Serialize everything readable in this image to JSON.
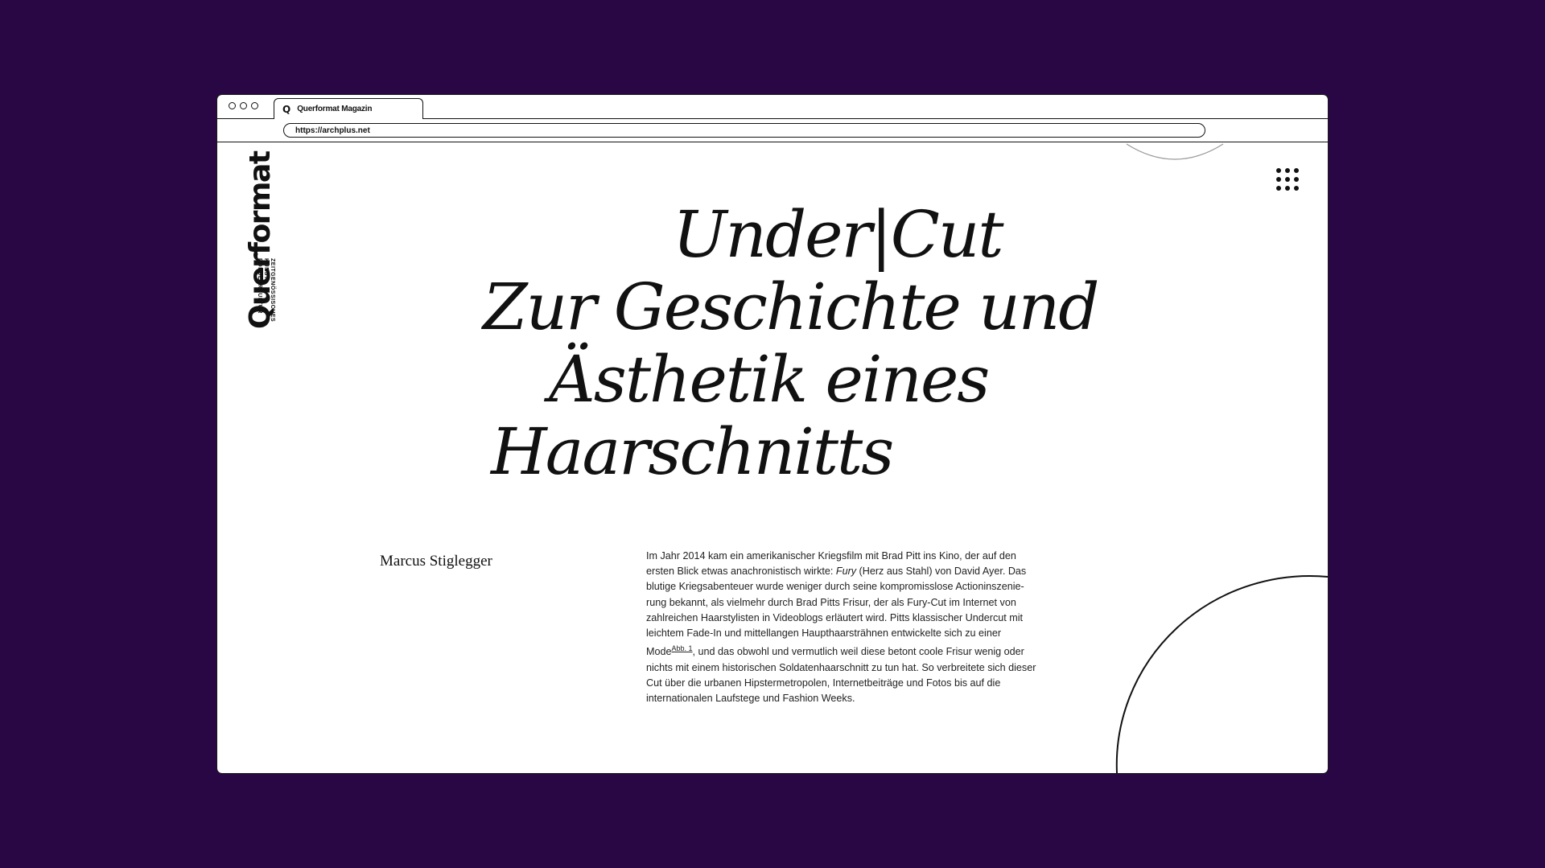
{
  "browser": {
    "tab_icon": "Q",
    "tab_title": "Querformat Magazin",
    "url": "https://archplus.net"
  },
  "site": {
    "logo_main": "Querformat",
    "logo_sub": [
      "ZEITGENÖSSISCHES",
      "KUNST",
      "POPULÄRKULTUR"
    ],
    "menu_icon": "grid-dots-icon"
  },
  "article": {
    "title_lines": [
      "Under|Cut",
      "Zur Geschichte und",
      "Ästhetik eines",
      "Haarschnitts"
    ],
    "author": "Marcus Stiglegger",
    "body_parts": {
      "p1": "Im Jahr 2014 kam ein amerikanischer Kriegsfilm mit Brad Pitt ins Kino, der auf den ersten Blick etwas anachronistisch wirkte: ",
      "em": "Fury",
      "p2": " (Herz aus Stahl) von David Ayer. Das blutige Kriegsabenteuer wurde weniger durch seine kompromisslose Actioninszenie­rung bekannt, als vielmehr durch Brad Pitts Frisur, der als Fury-Cut im Internet von zahlreichen Haarstylisten in Videoblogs erläutert wird. Pitts klassischer Undercut mit leichtem Fade-In und mittellangen Haupthaarsträhnen entwickelte sich zu einer Mode",
      "footnote": "Abb. 1",
      "p3": ", und das obwohl und vermutlich weil diese betont coole Frisur wenig oder nichts mit einem historischen Soldatenhaarschnitt zu tun hat. So verbreitete sich die­ser Cut über die urbanen Hipstermetropolen, Internetbeiträge und Fotos bis auf die internationalen Laufstege und Fashion Weeks."
    }
  },
  "colors": {
    "background": "#290744",
    "page": "#ffffff",
    "ink": "#111111"
  }
}
